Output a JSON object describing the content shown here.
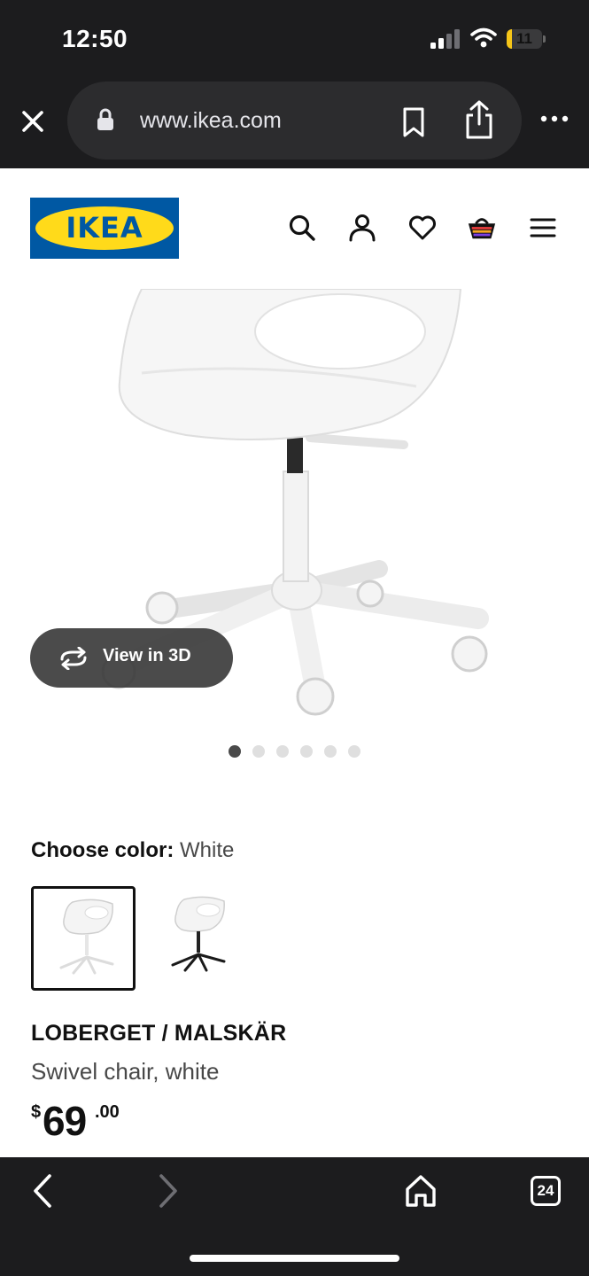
{
  "status_bar": {
    "time": "12:50",
    "battery_level": "11",
    "battery_percent": 11,
    "battery_color": "#f5c518",
    "signal_icon": "cellular-signal-icon",
    "wifi_icon": "wifi-icon"
  },
  "browser": {
    "url": "www.ikea.com",
    "icons": [
      "close-icon",
      "lock-icon",
      "bookmark-icon",
      "share-icon",
      "more-icon"
    ]
  },
  "header": {
    "logo_text": "IKEA",
    "brand_blue": "#0058a3",
    "brand_yellow": "#ffda1a",
    "icons": [
      "search-icon",
      "account-icon",
      "wishlist-heart-icon",
      "shopping-bag-icon",
      "hamburger-menu-icon"
    ]
  },
  "gallery": {
    "view_3d_label": "View in 3D",
    "image_count": 6,
    "active_index": 0
  },
  "product": {
    "choose_color_label": "Choose color:",
    "selected_color": "White",
    "color_options": [
      {
        "color": "White",
        "selected": true
      },
      {
        "color": "Black base",
        "selected": false
      }
    ],
    "name": "LOBERGET / MALSKÄR",
    "description": "Swivel chair, white",
    "price_currency": "$",
    "price_integer": "69",
    "price_decimal": ".00"
  },
  "toolbar": {
    "tab_count": "24",
    "icons": [
      "back-icon",
      "forward-icon",
      "home-icon",
      "tabs-icon"
    ]
  }
}
